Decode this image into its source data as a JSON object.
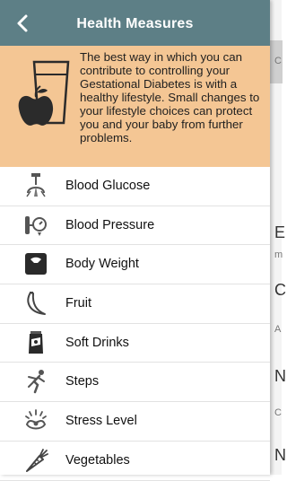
{
  "header": {
    "title": "Health Measures"
  },
  "banner": {
    "text": "The best way in which you can contribute to controlling your Gestational Diabetes is with a healthy lifestyle. Small changes to your lifestyle choices can protect you and your baby from further problems."
  },
  "measures": [
    {
      "label": "Blood Glucose",
      "icon": "glucose-meter-icon"
    },
    {
      "label": "Blood Pressure",
      "icon": "blood-pressure-icon"
    },
    {
      "label": "Body Weight",
      "icon": "scale-icon"
    },
    {
      "label": "Fruit",
      "icon": "banana-icon"
    },
    {
      "label": "Soft Drinks",
      "icon": "soda-can-icon"
    },
    {
      "label": "Steps",
      "icon": "running-icon"
    },
    {
      "label": "Stress Level",
      "icon": "stress-icon"
    },
    {
      "label": "Vegetables",
      "icon": "carrot-icon"
    }
  ],
  "background_app": {
    "partial_texts": [
      "C",
      "E",
      "m",
      "C",
      "A",
      "N",
      "C",
      "N"
    ]
  },
  "colors": {
    "header": "#5d7f86",
    "banner": "#f4c694"
  }
}
